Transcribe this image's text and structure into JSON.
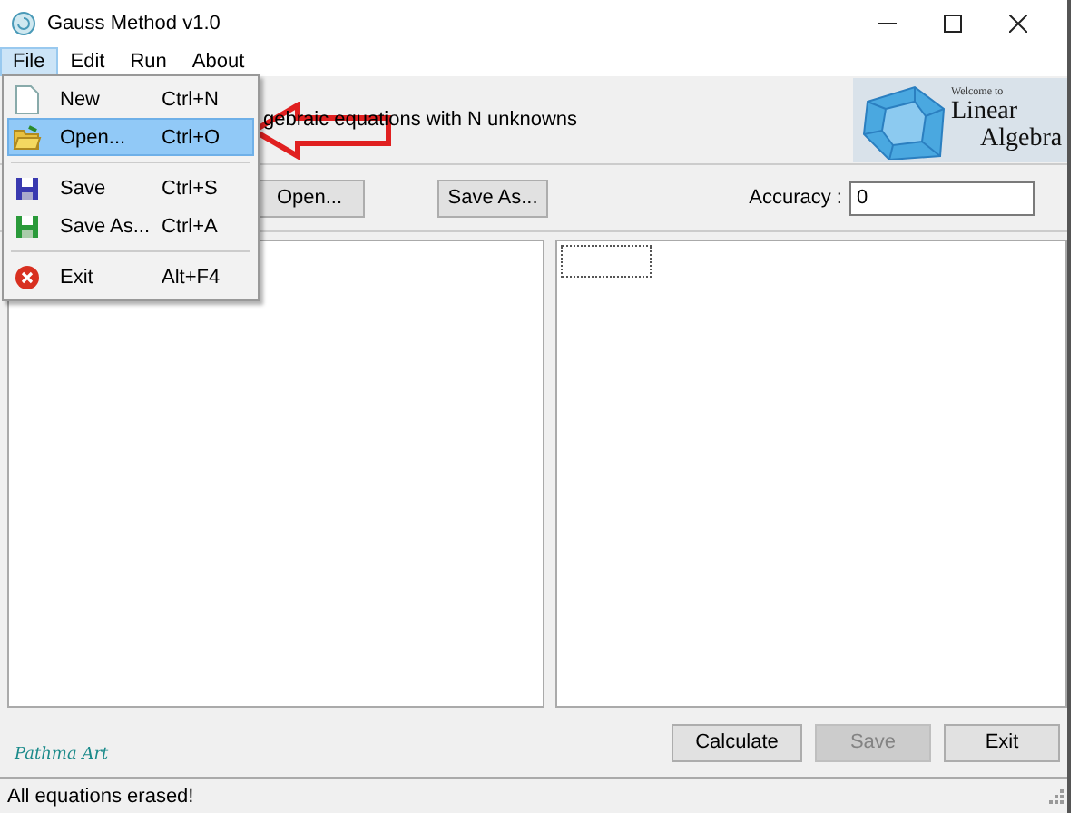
{
  "window": {
    "title": "Gauss Method v1.0"
  },
  "menu_bar": [
    {
      "label": "File",
      "selected": true
    },
    {
      "label": "Edit",
      "selected": false
    },
    {
      "label": "Run",
      "selected": false
    },
    {
      "label": "About",
      "selected": false
    }
  ],
  "file_menu": [
    {
      "kind": "item",
      "label": "New",
      "shortcut": "Ctrl+N",
      "selected": false
    },
    {
      "kind": "item",
      "label": "Open...",
      "shortcut": "Ctrl+O",
      "selected": true
    },
    {
      "kind": "separator"
    },
    {
      "kind": "item",
      "label": "Save",
      "shortcut": "Ctrl+S",
      "selected": false
    },
    {
      "kind": "item",
      "label": "Save As...",
      "shortcut": "Ctrl+A",
      "selected": false
    },
    {
      "kind": "separator"
    },
    {
      "kind": "item",
      "label": "Exit",
      "shortcut": "Alt+F4",
      "selected": false
    }
  ],
  "header": {
    "text": "gebraic equations with N unknowns",
    "logo": {
      "small": "Welcome to",
      "line1": "Linear",
      "line2": "Algebra"
    }
  },
  "toolbar": {
    "buttons": [
      {
        "label": "Open..."
      },
      {
        "label": "Save As..."
      }
    ],
    "accuracy": {
      "label": "Accuracy :",
      "value": "0"
    }
  },
  "brand": "Pathma Art",
  "buttons": [
    {
      "label": "Calculate",
      "disabled": false
    },
    {
      "label": "Save",
      "disabled": true
    },
    {
      "label": "Exit",
      "disabled": false
    }
  ],
  "status_bar": "All equations erased!"
}
